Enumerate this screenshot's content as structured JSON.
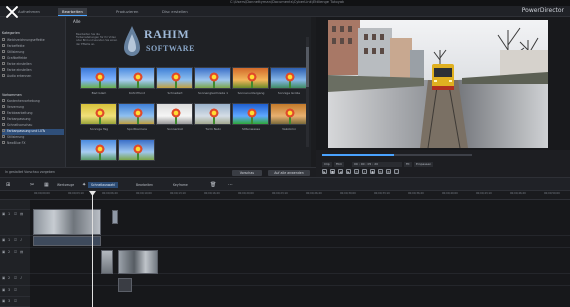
{
  "window": {
    "title": "C:\\Users\\Donnettyman\\Documents\\CyberLink\\Ettlienge Tutoyak"
  },
  "modes": [
    "Aufnehmen",
    "Bearbeiten",
    "Produzieren",
    "Disc erstellen"
  ],
  "active_mode": "Bearbeiten",
  "brand": "PowerDirector",
  "browser": {
    "header": "Alle",
    "description": "Bearbeiten Sie die Farbeinstellungen für Ihr Video oder Bild und wenden Sie einen der Effekte an.",
    "effects": [
      {
        "label": "Bad Glam",
        "style": "sat"
      },
      {
        "label": "Kühl Pfund",
        "style": "cool"
      },
      {
        "label": "Schnellart",
        "style": "warm"
      },
      {
        "label": "Sonnengleichzeile 1",
        "style": "warm2"
      },
      {
        "label": "Sonnenuntergang",
        "style": "sunset"
      },
      {
        "label": "Sonnige Große",
        "style": "cool2"
      },
      {
        "label": "Sonnige Tag",
        "style": "yellow"
      },
      {
        "label": "Sportbarriere",
        "style": "warm"
      },
      {
        "label": "Sonnenlist",
        "style": "bw"
      },
      {
        "label": "Turm Nebi",
        "style": "fade"
      },
      {
        "label": "Sittenwasse",
        "style": "vivid"
      },
      {
        "label": "Vakobrini",
        "style": "cool3"
      },
      {
        "label": "",
        "style": "cool"
      },
      {
        "label": "",
        "style": "warm2"
      }
    ],
    "footer_check": "In gestaltet Vorschau vorgeben",
    "btn_preview": "Vorschau",
    "btn_apply": "Auf alle anwenden"
  },
  "left_panel": {
    "section1": "Kategorien",
    "items1": [
      "Weichzeichnungseffekte",
      "Farbeffekte",
      "Stilisierung",
      "Grafikeffekte",
      "Farbe einstellen",
      "Farbe einstellen",
      "Audio erkennen"
    ],
    "section2": "Vorkommen",
    "items2": [
      "Kantenhervorhebung",
      "Verzerrung",
      "Farbbearbeitung",
      "Farbanpassung",
      "Schnellvorschau",
      "Farbanpassung und LUTs",
      "Stilisierung",
      "NewBlue FX"
    ],
    "selected_index": 5
  },
  "watermark": {
    "line1": "RAHIM",
    "line2": "SOFTWARE"
  },
  "preview": {
    "timecode": "00 ; 00 ; 05 ; 20",
    "fit": "Fit",
    "zoom": "Einpassen"
  },
  "timeline_toolbar": {
    "tools_label": "Werkzeuge",
    "blue_dd": "Schnellauswahl",
    "dd2": "Bearbeiten",
    "dd3": "Keyframe"
  },
  "ruler": [
    "00;00;00;00",
    "00;00;03;10",
    "00;00;06;20",
    "00;00;10;00",
    "00;00;13;10",
    "00;00;16;20",
    "00;00;20;00",
    "00;00;23;10",
    "00;00;26;20",
    "00;00;30;00",
    "00;00;33;10",
    "00;00;36;20",
    "00;00;40;00",
    "00;00;43;10",
    "00;00;46;20",
    "00;00;50;00"
  ],
  "tracks": [
    "1",
    "1",
    "2",
    "2",
    "3",
    "3"
  ]
}
